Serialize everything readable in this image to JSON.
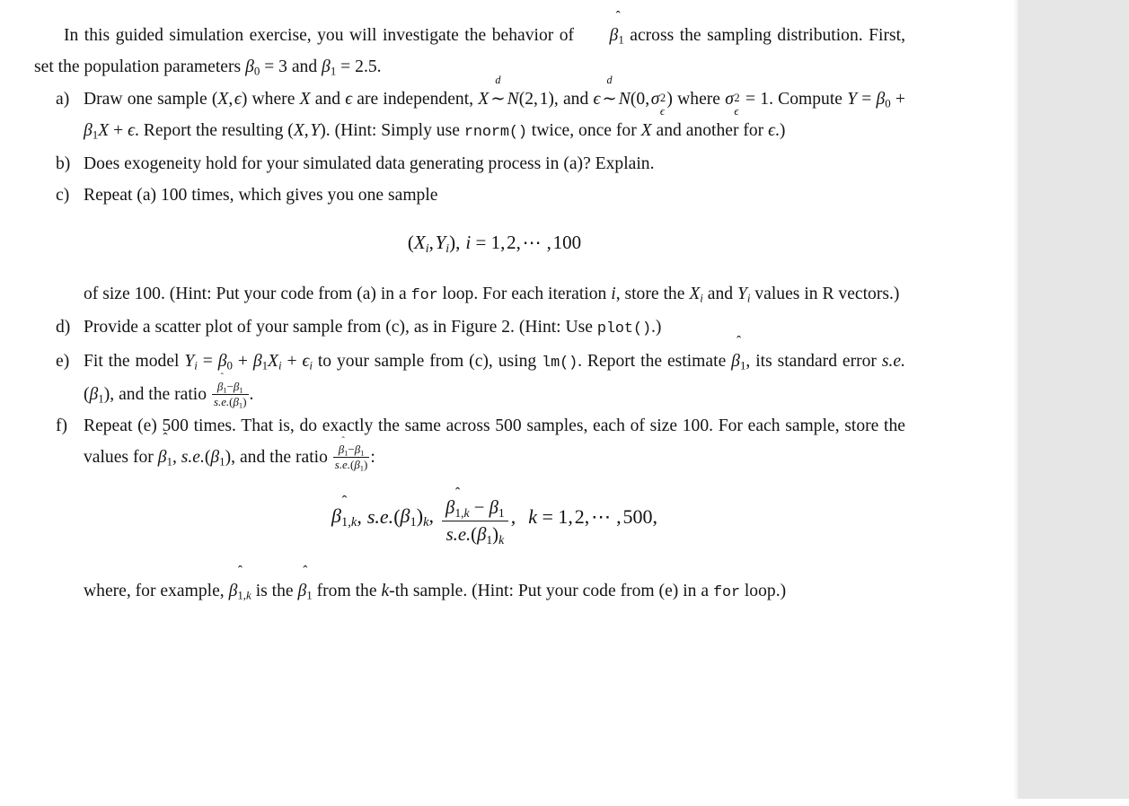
{
  "document": {
    "type": "pdf-page",
    "page_background": "#ffffff",
    "viewer_backdrop": "#e6e6e6",
    "text_color": "#141414"
  },
  "intro": {
    "text_1": "In this guided simulation exercise, you will investigate the behavior of ",
    "math_betahat1": "β̂₁",
    "text_2": " across the sampling distribution. First, set the population parameters ",
    "math_beta0_eq": "β₀ = 3",
    "text_3": " and ",
    "math_beta1_eq": "β₁ = 2.5",
    "text_4": "."
  },
  "items": [
    {
      "marker": "a)",
      "text_1": "Draw one sample ",
      "math_X_eps": "(X, ε)",
      "text_2": " where ",
      "math_X": "X",
      "text_3": " and ",
      "math_eps": "ε",
      "text_4": " are independent, ",
      "math_X_dist": "X ~d N(2, 1)",
      "text_5": ", and ",
      "math_eps_dist": "ε ~d N(0, σ²ε)",
      "text_6": " where ",
      "math_sigma_eq": "σ²ε = 1",
      "text_7": ". Compute ",
      "math_Y_model": "Y = β₀ + β₁X + ε",
      "text_8": ". Report the resulting ",
      "math_XY": "(X, Y)",
      "text_9": ". (Hint: Simply use ",
      "code_rnorm": "rnorm()",
      "text_10": " twice, once for ",
      "math_X_b": "X",
      "text_11": " and another for ",
      "math_eps_b": "ε",
      "text_12": ".)"
    },
    {
      "marker": "b)",
      "text_1": "Does exogeneity hold for your simulated data generating process in (a)? Explain."
    },
    {
      "marker": "c)",
      "text_1": "Repeat (a) 100 times, which gives you one sample",
      "equation": "(Xᵢ, Yᵢ),  i = 1, 2, ⋯ , 100",
      "cont_1": "of size 100. (Hint: Put your code from (a) in a ",
      "code_for": "for",
      "cont_2": " loop. For each iteration ",
      "math_i": "i",
      "cont_3": ", store the ",
      "math_Xi": "Xᵢ",
      "cont_4": " and ",
      "math_Yi": "Yᵢ",
      "cont_5": " values in R vectors.)"
    },
    {
      "marker": "d)",
      "text_1": "Provide a scatter plot of your sample from (c), as in Figure 2. (Hint: Use ",
      "code_plot": "plot()",
      "text_2": ".)"
    },
    {
      "marker": "e)",
      "text_1": "Fit the model ",
      "math_model": "Yᵢ = β₀ + β₁Xᵢ + εᵢ",
      "text_2": " to your sample from (c), using ",
      "code_lm": "lm()",
      "text_3": ". Report the estimate ",
      "math_betahat1": "β̂₁",
      "text_4": ", its standard error ",
      "math_se": "s.e.(β₁)",
      "text_5": ", and the ratio ",
      "frac_num": "β̂₁ − β₁",
      "frac_den": "s.e.(β₁)",
      "text_6": "."
    },
    {
      "marker": "f)",
      "text_1": "Repeat (e) 500 times. That is, do exactly the same across 500 samples, each of size 100. For each sample, store the values for ",
      "math_betahat1": "β̂₁",
      "text_2": ", ",
      "math_se": "s.e.(β₁)",
      "text_3": ", and the ratio ",
      "frac_num": "β̂₁ − β₁",
      "frac_den": "s.e.(β₁)",
      "text_4": ":",
      "equation": {
        "term1": "β̂₁,ₖ,",
        "term2": "s.e.(β₁)ₖ,",
        "frac_num": "β̂₁,ₖ − β₁",
        "frac_den": "s.e.(β₁)ₖ",
        "comma": ",",
        "range": "k = 1, 2, ⋯ , 500,"
      },
      "cont_1": "where, for example, ",
      "math_betahat1k": "β̂₁,ₖ",
      "cont_2": " is the ",
      "math_betahat1_b": "β̂₁",
      "cont_3": " from the ",
      "math_k": "k",
      "cont_4": "-th sample. (Hint: Put your code from (e) in a ",
      "code_for": "for",
      "cont_5": " loop.)"
    }
  ],
  "symbols": {
    "beta": "β",
    "epsilon": "ε",
    "sigma": "σ",
    "hat": "ˆ",
    "tilde_dist": "∼",
    "dots": "⋯",
    "minus": "−",
    "equals": "=",
    "cal_N": "N"
  }
}
